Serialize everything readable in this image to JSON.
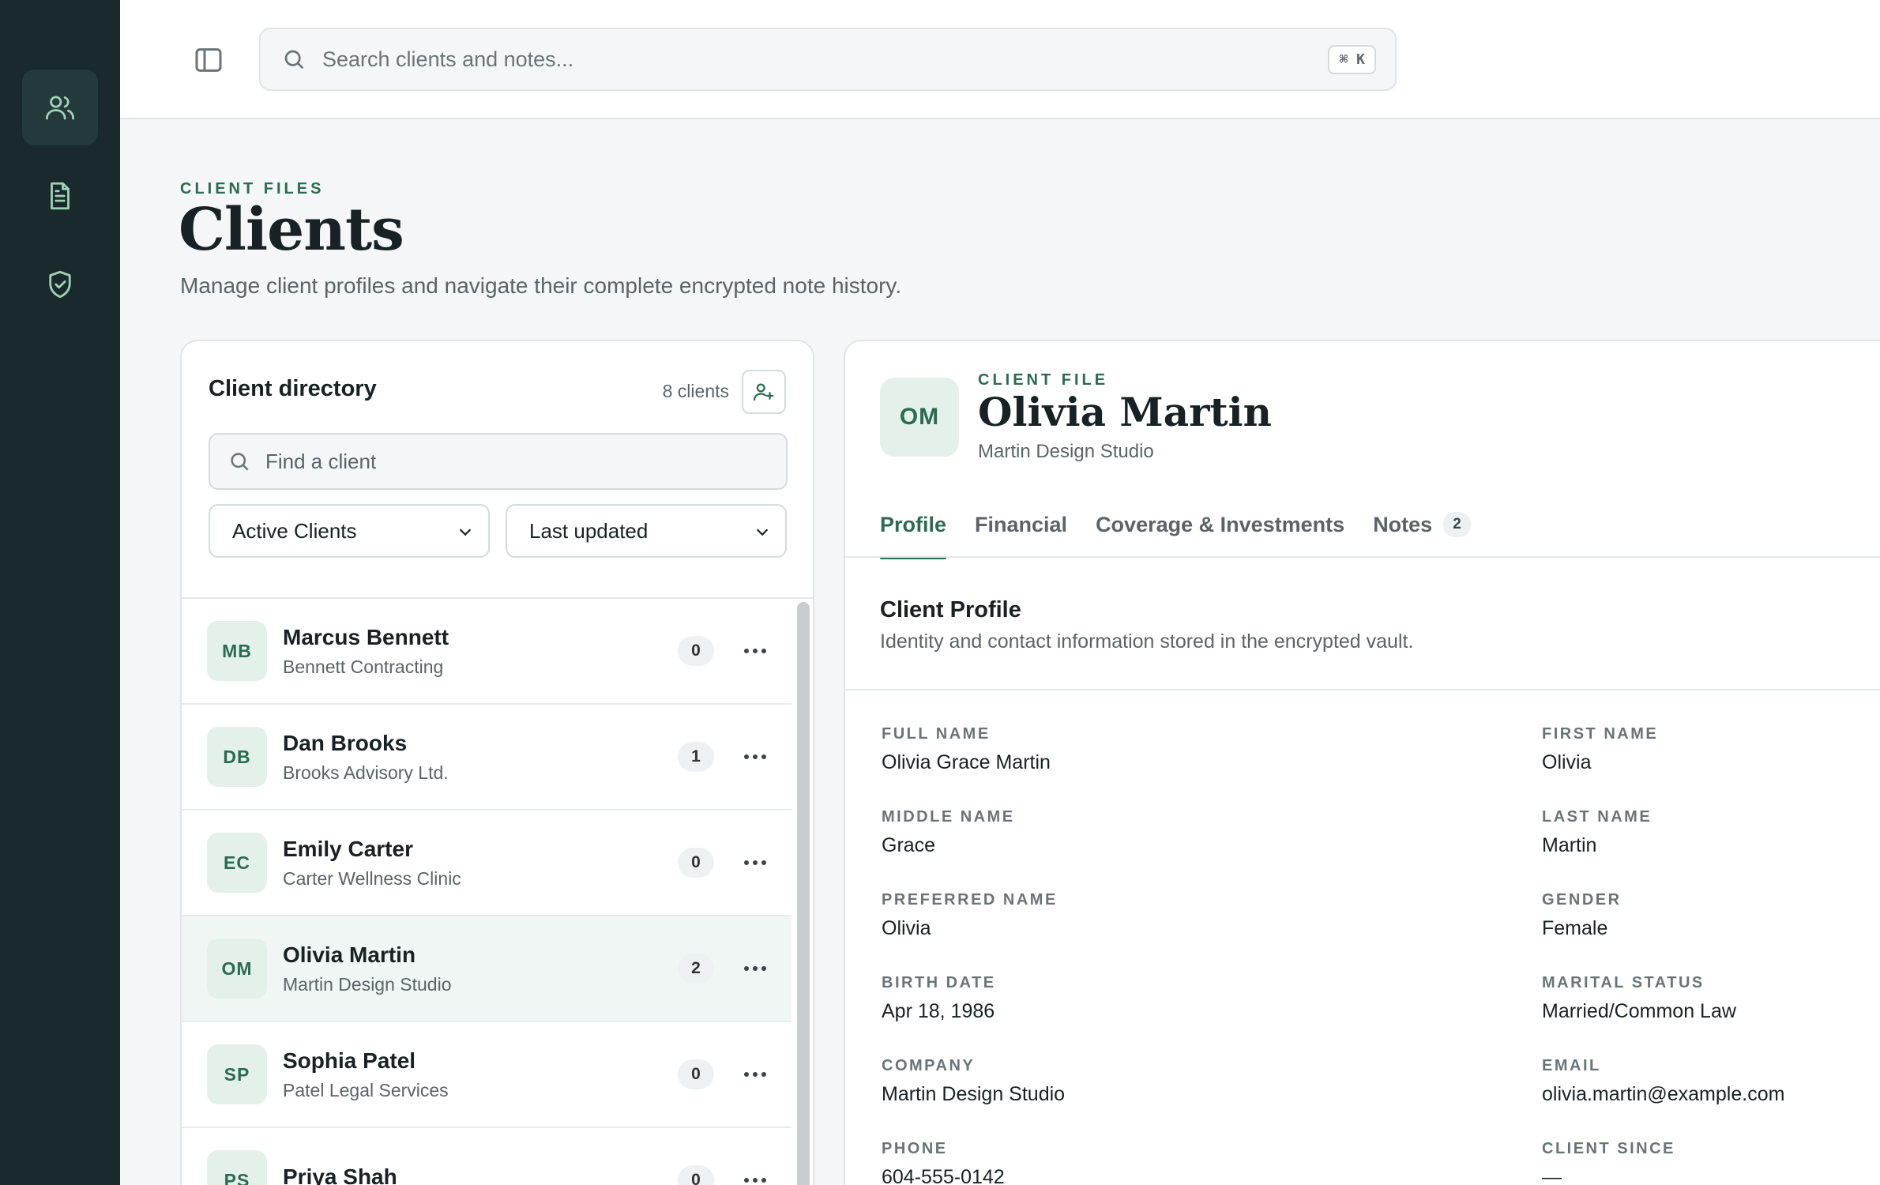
{
  "search": {
    "placeholder": "Search clients and notes...",
    "shortcut": "⌘ K"
  },
  "header": {
    "eyebrow": "CLIENT FILES",
    "title": "Clients",
    "subtitle": "Manage client profiles and navigate their complete encrypted note history."
  },
  "directory": {
    "title": "Client directory",
    "count": "8 clients",
    "find_placeholder": "Find a client",
    "filter_selected": "Active Clients",
    "sort_selected": "Last updated",
    "clients": [
      {
        "initials": "MB",
        "name": "Marcus Bennett",
        "company": "Bennett Contracting",
        "notes": "0"
      },
      {
        "initials": "DB",
        "name": "Dan Brooks",
        "company": "Brooks Advisory Ltd.",
        "notes": "1"
      },
      {
        "initials": "EC",
        "name": "Emily Carter",
        "company": "Carter Wellness Clinic",
        "notes": "0"
      },
      {
        "initials": "OM",
        "name": "Olivia Martin",
        "company": "Martin Design Studio",
        "notes": "2"
      },
      {
        "initials": "SP",
        "name": "Sophia Patel",
        "company": "Patel Legal Services",
        "notes": "0"
      },
      {
        "initials": "PS",
        "name": "Priya Shah",
        "company": "",
        "notes": "0"
      }
    ]
  },
  "file": {
    "initials": "OM",
    "eyebrow": "CLIENT FILE",
    "name": "Olivia Martin",
    "company": "Martin Design Studio",
    "tabs": [
      {
        "label": "Profile"
      },
      {
        "label": "Financial"
      },
      {
        "label": "Coverage & Investments"
      },
      {
        "label": "Notes",
        "badge": "2"
      }
    ],
    "section_title": "Client Profile",
    "section_desc": "Identity and contact information stored in the encrypted vault.",
    "fields": [
      {
        "label": "FULL NAME",
        "value": "Olivia Grace Martin"
      },
      {
        "label": "FIRST NAME",
        "value": "Olivia"
      },
      {
        "label": "MIDDLE NAME",
        "value": "Grace"
      },
      {
        "label": "LAST NAME",
        "value": "Martin"
      },
      {
        "label": "PREFERRED NAME",
        "value": "Olivia"
      },
      {
        "label": "GENDER",
        "value": "Female"
      },
      {
        "label": "BIRTH DATE",
        "value": "Apr 18, 1986"
      },
      {
        "label": "MARITAL STATUS",
        "value": "Married/Common Law"
      },
      {
        "label": "COMPANY",
        "value": "Martin Design Studio"
      },
      {
        "label": "EMAIL",
        "value": "olivia.martin@example.com"
      },
      {
        "label": "PHONE",
        "value": "604-555-0142"
      },
      {
        "label": "CLIENT SINCE",
        "value": "—"
      }
    ]
  },
  "colors": {
    "rail": "#1a2a2c",
    "accent": "#2b6b4f",
    "avatar_bg": "#e3f1ea"
  },
  "icons": {
    "rail": [
      "users-icon",
      "document-icon",
      "shield-check-icon"
    ]
  }
}
